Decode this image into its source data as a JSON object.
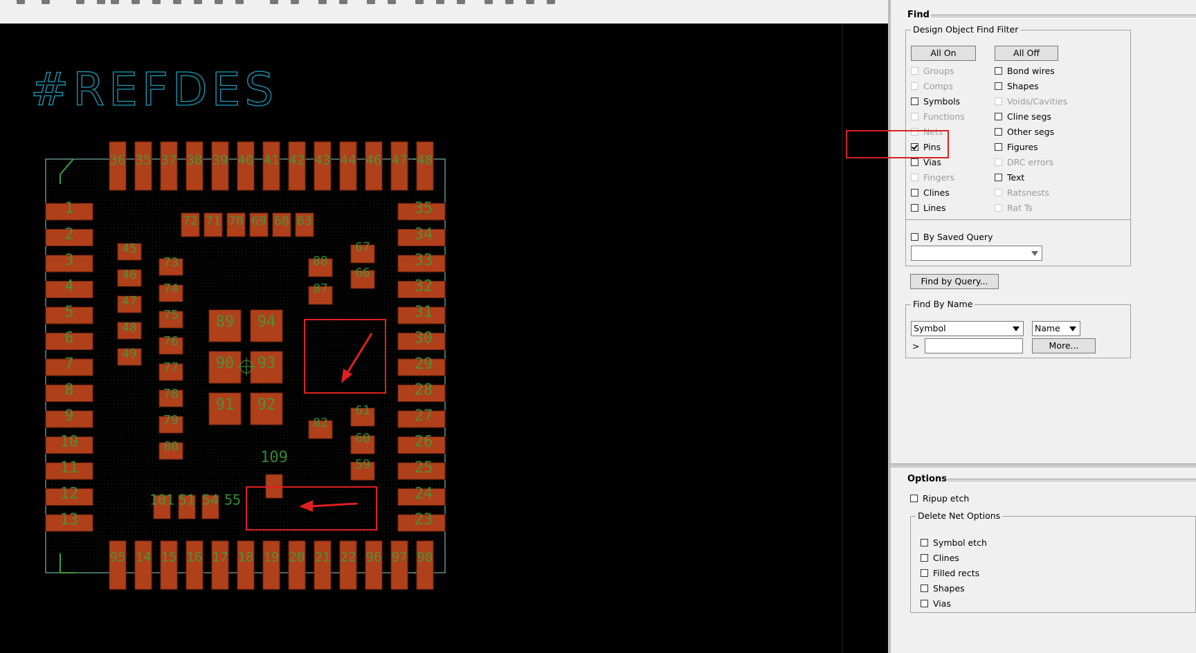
{
  "canvas": {
    "refdes": "#REFDES",
    "pins_top": [
      "36",
      "35",
      "37",
      "38",
      "39",
      "40",
      "41",
      "42",
      "43",
      "44",
      "46",
      "47",
      "48"
    ],
    "pins_left": [
      "1",
      "2",
      "3",
      "4",
      "5",
      "6",
      "7",
      "8",
      "9",
      "10",
      "11",
      "12",
      "13"
    ],
    "pins_right": [
      "35",
      "34",
      "33",
      "32",
      "31",
      "30",
      "29",
      "28",
      "27",
      "26",
      "25",
      "24",
      "23"
    ],
    "pins_bottom": [
      "95",
      "14",
      "15",
      "16",
      "17",
      "18",
      "19",
      "20",
      "21",
      "22",
      "96",
      "97",
      "98"
    ],
    "inner_top_row": [
      "72",
      "71",
      "70",
      "69",
      "68",
      "63"
    ],
    "inner_col_a": [
      "45",
      "46",
      "47",
      "48",
      "49"
    ],
    "inner_col_b": [
      "73",
      "74",
      "75",
      "76",
      "77",
      "78",
      "79",
      "80"
    ],
    "center_pads": [
      "89",
      "94",
      "90",
      "93",
      "91",
      "92"
    ],
    "right_inner": [
      "88",
      "87",
      "67",
      "66",
      "61",
      "60",
      "59",
      "82"
    ],
    "center_label": "109",
    "bottom_inner": [
      "101",
      "51",
      "54",
      "55"
    ],
    "colors": {
      "pad": "#b0401a",
      "silk": "#3f9f3f",
      "outline": "#8fd8c8",
      "refdes": "#1c9fbe",
      "annot": "#e02020"
    }
  },
  "find": {
    "title": "Find",
    "filter_legend": "Design Object Find Filter",
    "all_on": "All On",
    "all_off": "All Off",
    "left": [
      {
        "label": "Groups",
        "checked": false,
        "disabled": true
      },
      {
        "label": "Comps",
        "checked": false,
        "disabled": true
      },
      {
        "label": "Symbols",
        "checked": false,
        "disabled": false
      },
      {
        "label": "Functions",
        "checked": false,
        "disabled": true
      },
      {
        "label": "Nets",
        "checked": false,
        "disabled": true
      },
      {
        "label": "Pins",
        "checked": true,
        "disabled": false
      },
      {
        "label": "Vias",
        "checked": false,
        "disabled": false
      },
      {
        "label": "Fingers",
        "checked": false,
        "disabled": true
      },
      {
        "label": "Clines",
        "checked": false,
        "disabled": false
      },
      {
        "label": "Lines",
        "checked": false,
        "disabled": false
      }
    ],
    "right": [
      {
        "label": "Bond wires",
        "checked": false,
        "disabled": false
      },
      {
        "label": "Shapes",
        "checked": false,
        "disabled": false
      },
      {
        "label": "Voids/Cavities",
        "checked": false,
        "disabled": true
      },
      {
        "label": "Cline segs",
        "checked": false,
        "disabled": false
      },
      {
        "label": "Other segs",
        "checked": false,
        "disabled": false
      },
      {
        "label": "Figures",
        "checked": false,
        "disabled": false
      },
      {
        "label": "DRC errors",
        "checked": false,
        "disabled": true
      },
      {
        "label": "Text",
        "checked": false,
        "disabled": false
      },
      {
        "label": "Ratsnests",
        "checked": false,
        "disabled": true
      },
      {
        "label": "Rat Ts",
        "checked": false,
        "disabled": true
      }
    ],
    "by_saved_query": "By Saved Query",
    "saved_query_value": "",
    "find_by_query": "Find by Query...",
    "find_by_name_legend": "Find By Name",
    "name_type": "Symbol",
    "name_mode": "Name",
    "prompt": ">",
    "name_value": "",
    "more": "More..."
  },
  "options": {
    "title": "Options",
    "ripup_etch": "Ripup etch",
    "delete_net_legend": "Delete Net Options",
    "items": [
      "Symbol etch",
      "Clines",
      "Filled rects",
      "Shapes",
      "Vias"
    ]
  }
}
